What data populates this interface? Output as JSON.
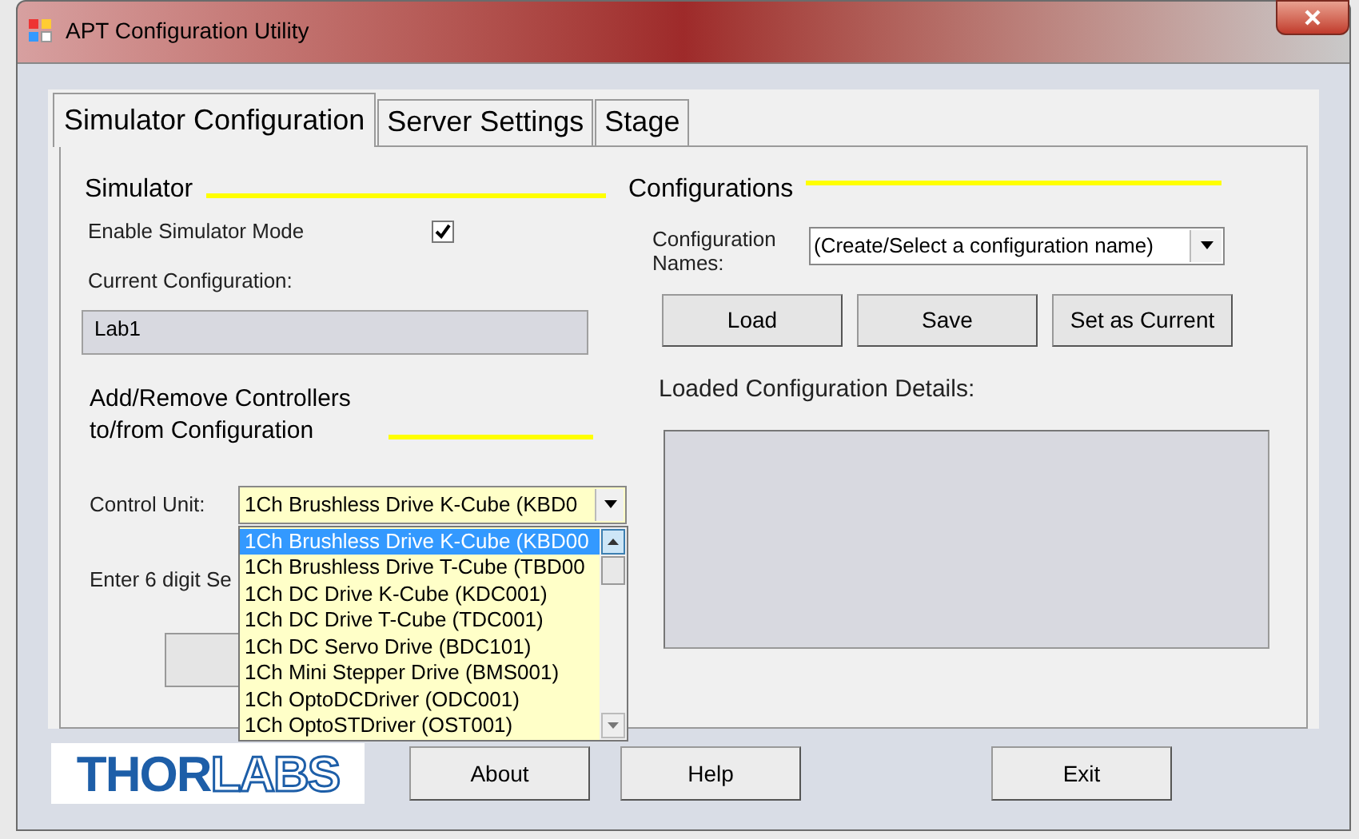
{
  "window": {
    "title": "APT Configuration Utility"
  },
  "tabs": [
    {
      "label": "Simulator Configuration",
      "selected": true
    },
    {
      "label": "Server Settings",
      "selected": false
    },
    {
      "label": "Stage",
      "selected": false
    }
  ],
  "simulator": {
    "heading": "Simulator",
    "enable_label": "Enable Simulator Mode",
    "enable_checked": true,
    "current_label": "Current Configuration:",
    "current_value": "Lab1"
  },
  "controllers": {
    "heading_lines": [
      "Add/Remove Controllers",
      "to/from Configuration"
    ],
    "control_unit_label": "Control Unit:",
    "control_unit_value": "1Ch Brushless Drive K-Cube (KBD0",
    "options": [
      {
        "label": "1Ch Brushless Drive K-Cube (KBD00",
        "selected": true
      },
      {
        "label": "1Ch Brushless Drive T-Cube (TBD00",
        "selected": false
      },
      {
        "label": "1Ch DC Drive K-Cube (KDC001)",
        "selected": false
      },
      {
        "label": "1Ch DC Drive T-Cube (TDC001)",
        "selected": false
      },
      {
        "label": "1Ch DC Servo Drive (BDC101)",
        "selected": false
      },
      {
        "label": "1Ch Mini Stepper Drive (BMS001)",
        "selected": false
      },
      {
        "label": "1Ch OptoDCDriver (ODC001)",
        "selected": false
      },
      {
        "label": "1Ch OptoSTDriver (OST001)",
        "selected": false
      }
    ],
    "serial_label": "Enter 6 digit Se"
  },
  "configurations": {
    "heading": "Configurations",
    "names_label_lines": [
      "Configuration",
      "Names:"
    ],
    "names_value": "(Create/Select a configuration name)",
    "buttons": [
      "Load",
      "Save",
      "Set as Current"
    ],
    "details_label": "Loaded Configuration Details:"
  },
  "footer": {
    "logo": {
      "bold": "THOR",
      "light": "LABS"
    },
    "buttons": [
      "About",
      "Help",
      "Exit"
    ]
  }
}
